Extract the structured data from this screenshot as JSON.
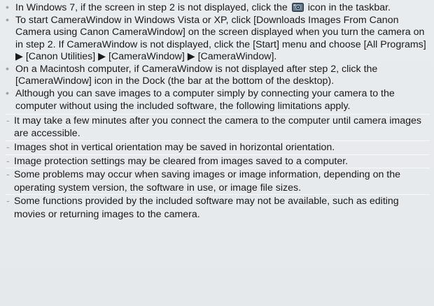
{
  "notes": [
    {
      "bullet": "•",
      "text_before_icon": "In Windows 7, if the screen in step 2 is not displayed, click the",
      "icon": "camerawindow-taskbar-icon",
      "text_after_icon": "icon in the taskbar."
    },
    {
      "bullet": "•",
      "text": "To start CameraWindow in Windows Vista or XP, click [Downloads Images From Canon Camera using Canon CameraWindow] on the screen displayed when you turn the camera on in step 2. If CameraWindow is not displayed, click the [Start] menu and choose [All Programs] ▶ [Canon Utilities] ▶ [CameraWindow] ▶ [CameraWindow]."
    },
    {
      "bullet": "•",
      "text": "On a Macintosh computer, if CameraWindow is not displayed after step 2, click the [CameraWindow] icon in the Dock (the bar at the bottom of the desktop)."
    },
    {
      "bullet": "•",
      "text": "Although you can save images to a computer simply by connecting your camera to the computer without using the included software, the following limitations apply.",
      "subitems": [
        {
          "dash": "-",
          "text": "It may take a few minutes after you connect the camera to the computer until camera images are accessible."
        },
        {
          "dash": "-",
          "text": "Images shot in vertical orientation may be saved in horizontal orientation."
        },
        {
          "dash": "-",
          "text": "Image protection settings may be cleared from images saved to a computer."
        },
        {
          "dash": "-",
          "text": "Some problems may occur when saving images or image information, depending on the operating system version, the software in use, or image file sizes."
        },
        {
          "dash": "-",
          "text": "Some functions provided by the included software may not be available, such as editing movies or returning images to the camera."
        }
      ]
    }
  ]
}
